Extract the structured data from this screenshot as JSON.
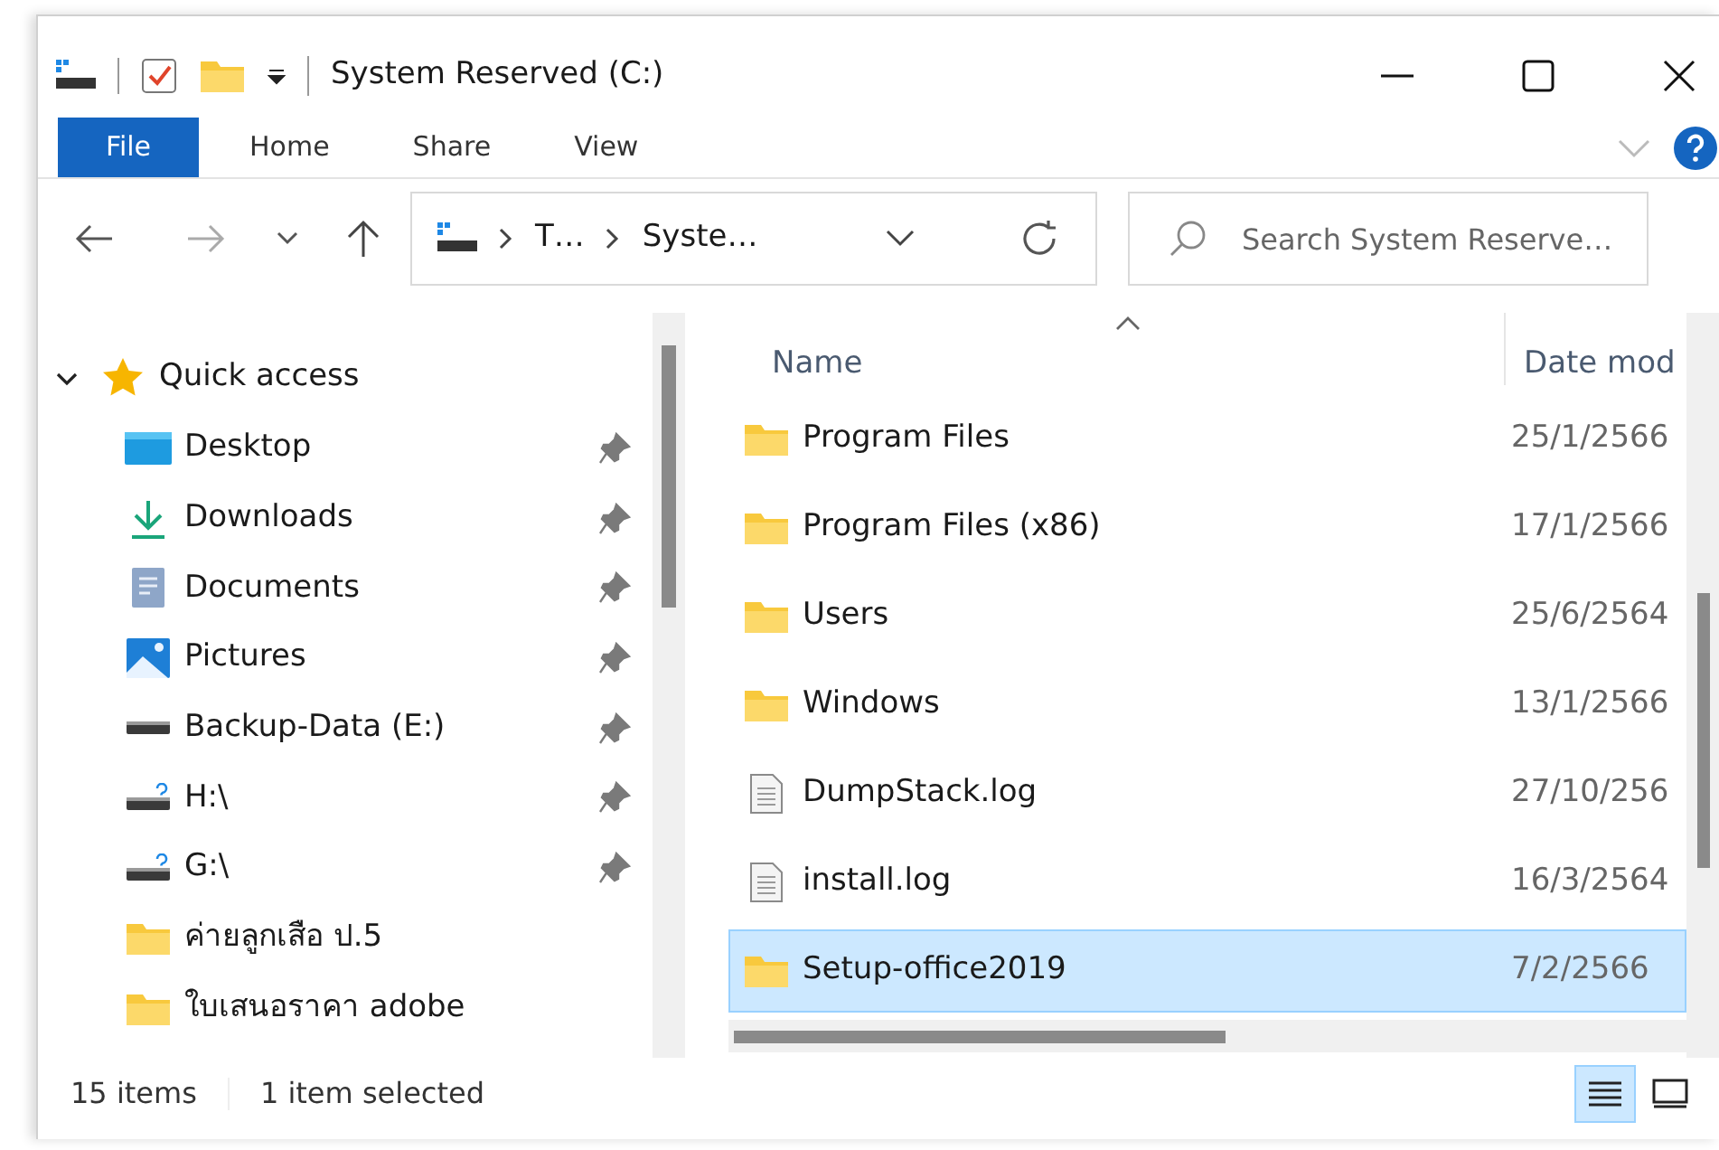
{
  "window": {
    "title": "System Reserved (C:)"
  },
  "ribbon_tabs": [
    {
      "label": "File",
      "selected": true
    },
    {
      "label": "Home",
      "selected": false
    },
    {
      "label": "Share",
      "selected": false
    },
    {
      "label": "View",
      "selected": false
    }
  ],
  "breadcrumb": [
    "T…",
    "Syste…"
  ],
  "search": {
    "placeholder": "Search System Reserve…"
  },
  "sidebar": {
    "label": "Quick access",
    "expanded": true,
    "children": [
      {
        "label": "Desktop",
        "kind": "desktop",
        "pinned": true
      },
      {
        "label": "Downloads",
        "kind": "download",
        "pinned": true
      },
      {
        "label": "Documents",
        "kind": "documents",
        "pinned": true
      },
      {
        "label": "Pictures",
        "kind": "pictures",
        "pinned": true
      },
      {
        "label": "Backup-Data (E:)",
        "kind": "drive",
        "pinned": true
      },
      {
        "label": "H:\\",
        "kind": "netdrive",
        "pinned": true
      },
      {
        "label": "G:\\",
        "kind": "netdrive",
        "pinned": true
      },
      {
        "label": "ค่ายลูกเสือ ป.5",
        "kind": "folder",
        "pinned": false
      },
      {
        "label": "ใบเสนอราคา adobe",
        "kind": "folder",
        "pinned": false
      }
    ]
  },
  "table": {
    "columns": [
      "Name",
      "Date mod"
    ],
    "rows": [
      {
        "name": "Program Files",
        "date": "25/1/2566",
        "kind": "folder",
        "selected": false
      },
      {
        "name": "Program Files (x86)",
        "date": "17/1/2566",
        "kind": "folder",
        "selected": false
      },
      {
        "name": "Users",
        "date": "25/6/2564",
        "kind": "folder",
        "selected": false
      },
      {
        "name": "Windows",
        "date": "13/1/2566",
        "kind": "folder",
        "selected": false
      },
      {
        "name": "DumpStack.log",
        "date": "27/10/256",
        "kind": "file",
        "selected": false
      },
      {
        "name": "install.log",
        "date": "16/3/2564",
        "kind": "file",
        "selected": false
      },
      {
        "name": "Setup-office2019",
        "date": "7/2/2566",
        "kind": "folder",
        "selected": true
      }
    ]
  },
  "status_bar": {
    "count": "15 items",
    "selection": "1 item selected"
  },
  "view_buttons": [
    {
      "kind": "details",
      "selected": true
    },
    {
      "kind": "large-icons",
      "selected": false
    }
  ]
}
